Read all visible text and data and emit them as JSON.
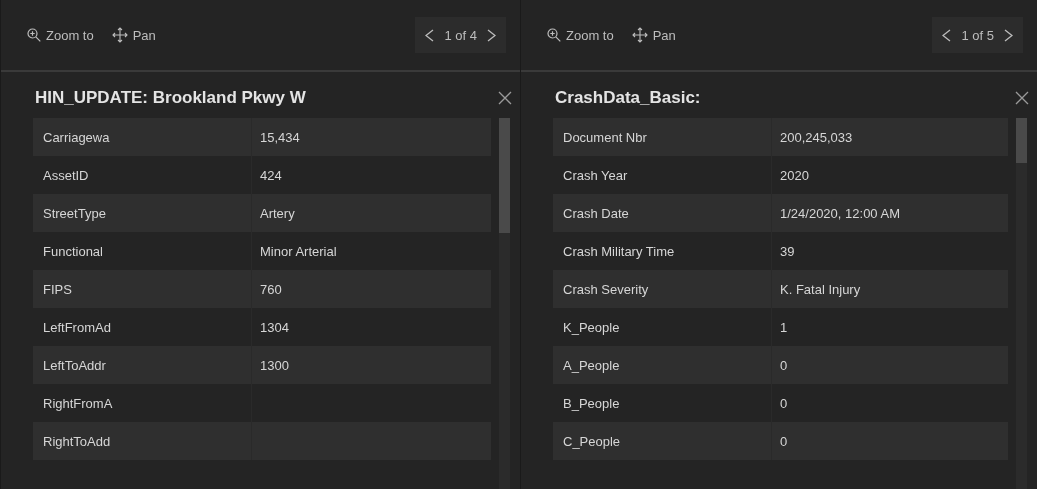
{
  "panels": [
    {
      "toolbar": {
        "zoom_label": "Zoom to",
        "pan_label": "Pan",
        "pager": "1 of 4"
      },
      "title": "HIN_UPDATE: Brookland Pkwy W",
      "rows": [
        {
          "field": "Carriagewa",
          "value": "15,434"
        },
        {
          "field": "AssetID",
          "value": "424"
        },
        {
          "field": "StreetType",
          "value": "Artery"
        },
        {
          "field": "Functional",
          "value": "Minor Arterial"
        },
        {
          "field": "FIPS",
          "value": "760"
        },
        {
          "field": "LeftFromAd",
          "value": "1304"
        },
        {
          "field": "LeftToAddr",
          "value": "1300"
        },
        {
          "field": "RightFromA"
        },
        {
          "field": "RightToAdd"
        }
      ]
    },
    {
      "toolbar": {
        "zoom_label": "Zoom to",
        "pan_label": "Pan",
        "pager": "1 of 5"
      },
      "title": "CrashData_Basic:",
      "rows": [
        {
          "field": "Document Nbr",
          "value": "200,245,033"
        },
        {
          "field": "Crash Year",
          "value": "2020"
        },
        {
          "field": "Crash Date",
          "value": "1/24/2020, 12:00 AM"
        },
        {
          "field": "Crash Military Time",
          "value": "39"
        },
        {
          "field": "Crash Severity",
          "value": "K. Fatal Injury"
        },
        {
          "field": "K_People",
          "value": "1"
        },
        {
          "field": "A_People",
          "value": "0"
        },
        {
          "field": "B_People",
          "value": "0"
        },
        {
          "field": "C_People",
          "value": "0"
        }
      ]
    }
  ]
}
